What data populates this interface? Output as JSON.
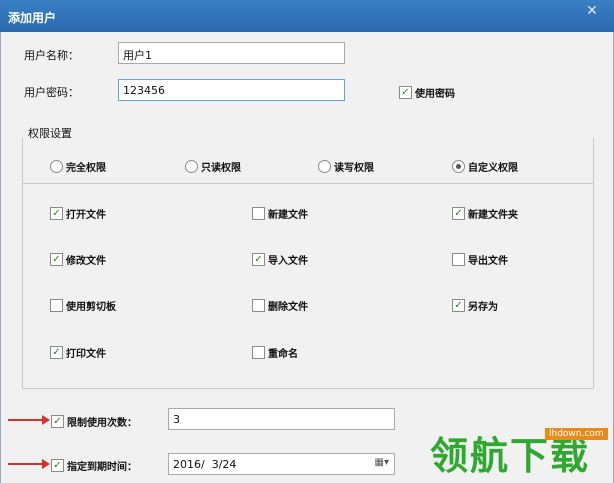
{
  "window": {
    "title": "添加用户",
    "close_glyph": "✕"
  },
  "fields": {
    "username_label": "用户名称：",
    "username_value": "用户1",
    "password_label": "用户密码：",
    "password_value": "123456",
    "use_password_label": "使用密码"
  },
  "permissions": {
    "group_label": "权限设置",
    "radios": [
      {
        "label": "完全权限",
        "selected": false
      },
      {
        "label": "只读权限",
        "selected": false
      },
      {
        "label": "读写权限",
        "selected": false
      },
      {
        "label": "自定义权限",
        "selected": true
      }
    ],
    "checks": [
      {
        "label": "打开文件",
        "checked": true
      },
      {
        "label": "新建文件",
        "checked": false
      },
      {
        "label": "新建文件夹",
        "checked": true
      },
      {
        "label": "修改文件",
        "checked": true
      },
      {
        "label": "导入文件",
        "checked": true
      },
      {
        "label": "导出文件",
        "checked": false
      },
      {
        "label": "使用剪切板",
        "checked": false
      },
      {
        "label": "删除文件",
        "checked": false
      },
      {
        "label": "另存为",
        "checked": true
      },
      {
        "label": "打印文件",
        "checked": true
      },
      {
        "label": "重命名",
        "checked": false
      }
    ]
  },
  "limits": {
    "limit_count_label": "限制使用次数：",
    "limit_count_value": "3",
    "expiry_label": "指定到期时间：",
    "expiry_value": "2016/  3/24"
  },
  "watermark": {
    "text": "领航下载",
    "url": "lhdown.com"
  },
  "colors": {
    "titlebar": "#2f72b8",
    "check": "#2d7a2d",
    "arrow": "#d9322a",
    "watermark": "#2fa830"
  }
}
